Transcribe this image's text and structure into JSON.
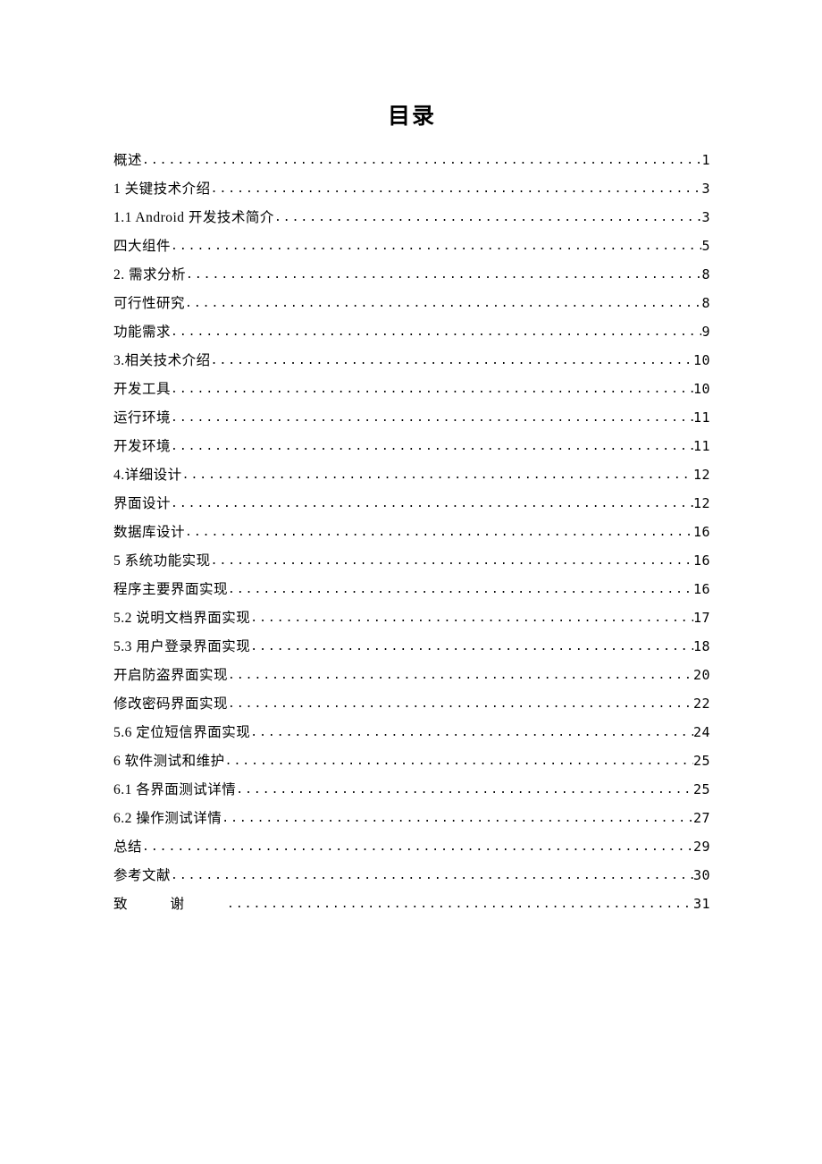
{
  "title": "目录",
  "entries": [
    {
      "label": "概述",
      "page": "1",
      "spaced": false
    },
    {
      "label": "1 关键技术介绍",
      "page": "3",
      "spaced": false
    },
    {
      "label": "1.1 Android 开发技术简介 ",
      "page": "3",
      "spaced": false
    },
    {
      "label": "四大组件",
      "page": "5",
      "spaced": false
    },
    {
      "label": "2. 需求分析",
      "page": "8",
      "spaced": false
    },
    {
      "label": "可行性研究",
      "page": "8",
      "spaced": false
    },
    {
      "label": "功能需求",
      "page": "9",
      "spaced": false
    },
    {
      "label": "3.相关技术介绍",
      "page": "10",
      "spaced": false
    },
    {
      "label": "开发工具",
      "page": "10",
      "spaced": false
    },
    {
      "label": "运行环境",
      "page": "11",
      "spaced": false
    },
    {
      "label": "开发环境",
      "page": "11",
      "spaced": false
    },
    {
      "label": "4.详细设计",
      "page": "12",
      "spaced": false
    },
    {
      "label": "界面设计",
      "page": "12",
      "spaced": false
    },
    {
      "label": "数据库设计",
      "page": "16",
      "spaced": false
    },
    {
      "label": "5 系统功能实现 ",
      "page": "16",
      "spaced": false
    },
    {
      "label": "程序主要界面实现",
      "page": "16",
      "spaced": false
    },
    {
      "label": "5.2 说明文档界面实现",
      "page": "17",
      "spaced": false
    },
    {
      "label": "5.3 用户登录界面实现",
      "page": "18",
      "spaced": false
    },
    {
      "label": "开启防盗界面实现",
      "page": "20",
      "spaced": false
    },
    {
      "label": "修改密码界面实现",
      "page": "22",
      "spaced": false
    },
    {
      "label": "5.6 定位短信界面实现",
      "page": "24",
      "spaced": false
    },
    {
      "label": "6 软件测试和维护 ",
      "page": "25",
      "spaced": false
    },
    {
      "label": "6.1 各界面测试详情",
      "page": "25",
      "spaced": false
    },
    {
      "label": "6.2 操作测试详情",
      "page": "27",
      "spaced": false
    },
    {
      "label": "总结",
      "page": "29",
      "spaced": false
    },
    {
      "label": "参考文献",
      "page": "30",
      "spaced": false
    },
    {
      "label": "致谢",
      "page": "31",
      "spaced": true
    }
  ]
}
